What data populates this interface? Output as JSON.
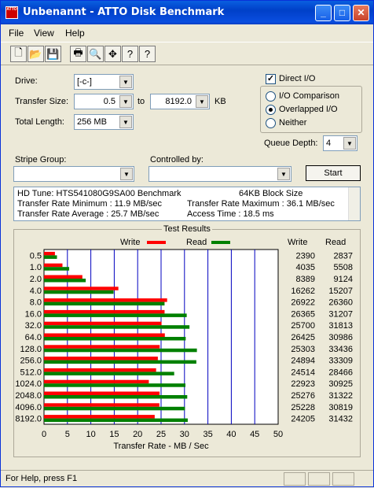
{
  "window": {
    "title": "Unbenannt - ATTO Disk Benchmark",
    "icon_text": "ATTO",
    "minimize": "_",
    "maximize": "□",
    "close": "✕"
  },
  "menu": [
    "File",
    "View",
    "Help"
  ],
  "toolbar_icons": [
    "new-icon",
    "open-icon",
    "save-icon",
    "print-icon",
    "print-preview-icon",
    "move-icon",
    "help-icon",
    "context-help-icon"
  ],
  "settings": {
    "drive_label": "Drive:",
    "drive_value": "[-c-]",
    "transfer_size_label": "Transfer Size:",
    "transfer_from": "0.5",
    "to_label": "to",
    "transfer_to": "8192.0",
    "kb_label": "KB",
    "total_length_label": "Total Length:",
    "total_length_value": "256 MB",
    "direct_io_label": "Direct I/O",
    "io_comparison_label": "I/O Comparison",
    "overlapped_io_label": "Overlapped I/O",
    "neither_label": "Neither",
    "queue_depth_label": "Queue Depth:",
    "queue_depth_value": "4",
    "stripe_group_label": "Stripe Group:",
    "controlled_by_label": "Controlled by:",
    "start_label": "Start"
  },
  "info": {
    "line1_left": "HD Tune: HTS541080G9SA00 Benchmark",
    "line1_right": "64KB Block Size",
    "line2_left": "Transfer Rate Minimum : 11.9 MB/sec",
    "line2_right": "Transfer Rate Maximum : 36.1 MB/sec",
    "line3_left": "Transfer Rate Average : 25.7 MB/sec",
    "line3_right": "Access Time          : 18.5 ms"
  },
  "results": {
    "group_label": "Test Results",
    "legend_write": "Write",
    "legend_read": "Read",
    "col_write": "Write",
    "col_read": "Read"
  },
  "colors": {
    "write": "#ff0000",
    "read": "#008000",
    "grid": "#0000c0",
    "titlebar": "#0a4ee0"
  },
  "chart_data": {
    "type": "bar",
    "orientation": "horizontal",
    "categories": [
      "0.5",
      "1.0",
      "2.0",
      "4.0",
      "8.0",
      "16.0",
      "32.0",
      "64.0",
      "128.0",
      "256.0",
      "512.0",
      "1024.0",
      "2048.0",
      "4096.0",
      "8192.0"
    ],
    "series": [
      {
        "name": "Write",
        "values": [
          2390,
          4035,
          8389,
          16262,
          26922,
          26365,
          25700,
          26425,
          25303,
          24894,
          24514,
          22923,
          25276,
          25228,
          24205
        ]
      },
      {
        "name": "Read",
        "values": [
          2837,
          5508,
          9124,
          15207,
          26360,
          31207,
          31813,
          30986,
          33436,
          33309,
          28466,
          30925,
          31322,
          30819,
          31432
        ]
      }
    ],
    "xlabel": "Transfer Rate - MB / Sec",
    "xticks": [
      "0",
      "5",
      "10",
      "15",
      "20",
      "25",
      "30",
      "35",
      "40",
      "45",
      "50"
    ],
    "xlim": [
      0,
      50
    ],
    "grid": true
  },
  "status": {
    "text": "For Help, press F1"
  }
}
